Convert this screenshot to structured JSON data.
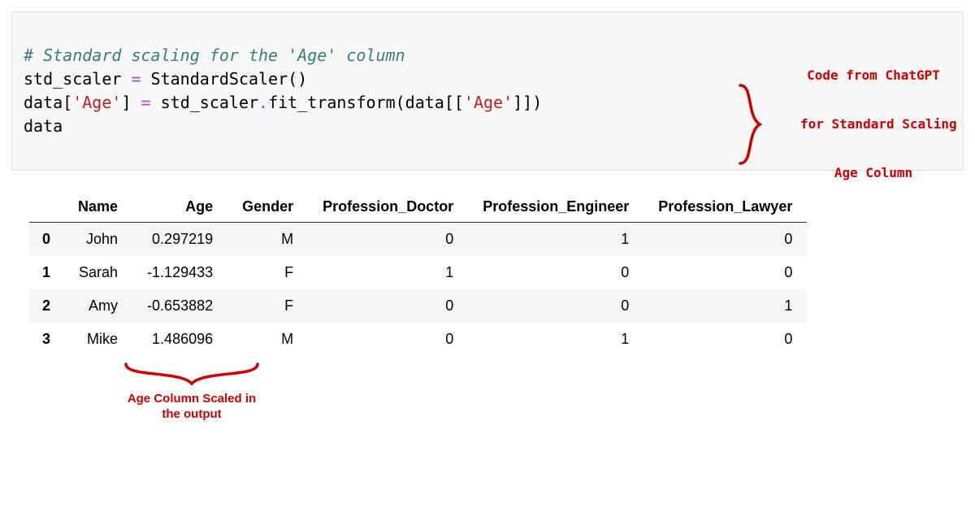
{
  "code": {
    "comment": "# Standard scaling for the 'Age' column",
    "line2_left": "std_scaler ",
    "line2_eq": "=",
    "line2_right": " StandardScaler()",
    "line3_a": "data[",
    "line3_str1": "'Age'",
    "line3_b": "] ",
    "line3_eq": "=",
    "line3_c": " std_scaler",
    "line3_dot": ".",
    "line3_d": "fit_transform(data[[",
    "line3_str2": "'Age'",
    "line3_e": "]])",
    "line4": "data"
  },
  "annotation_right": {
    "line1": "Code from ChatGPT",
    "line2": "for Standard Scaling",
    "line3": "Age Column"
  },
  "annotation_bottom": {
    "line1": "Age Column Scaled in",
    "line2": "the output"
  },
  "table": {
    "headers": [
      "Name",
      "Age",
      "Gender",
      "Profession_Doctor",
      "Profession_Engineer",
      "Profession_Lawyer"
    ],
    "rows": [
      {
        "idx": "0",
        "cells": [
          "John",
          "0.297219",
          "M",
          "0",
          "1",
          "0"
        ]
      },
      {
        "idx": "1",
        "cells": [
          "Sarah",
          "-1.129433",
          "F",
          "1",
          "0",
          "0"
        ]
      },
      {
        "idx": "2",
        "cells": [
          "Amy",
          "-0.653882",
          "F",
          "0",
          "0",
          "1"
        ]
      },
      {
        "idx": "3",
        "cells": [
          "Mike",
          "1.486096",
          "M",
          "0",
          "1",
          "0"
        ]
      }
    ]
  }
}
